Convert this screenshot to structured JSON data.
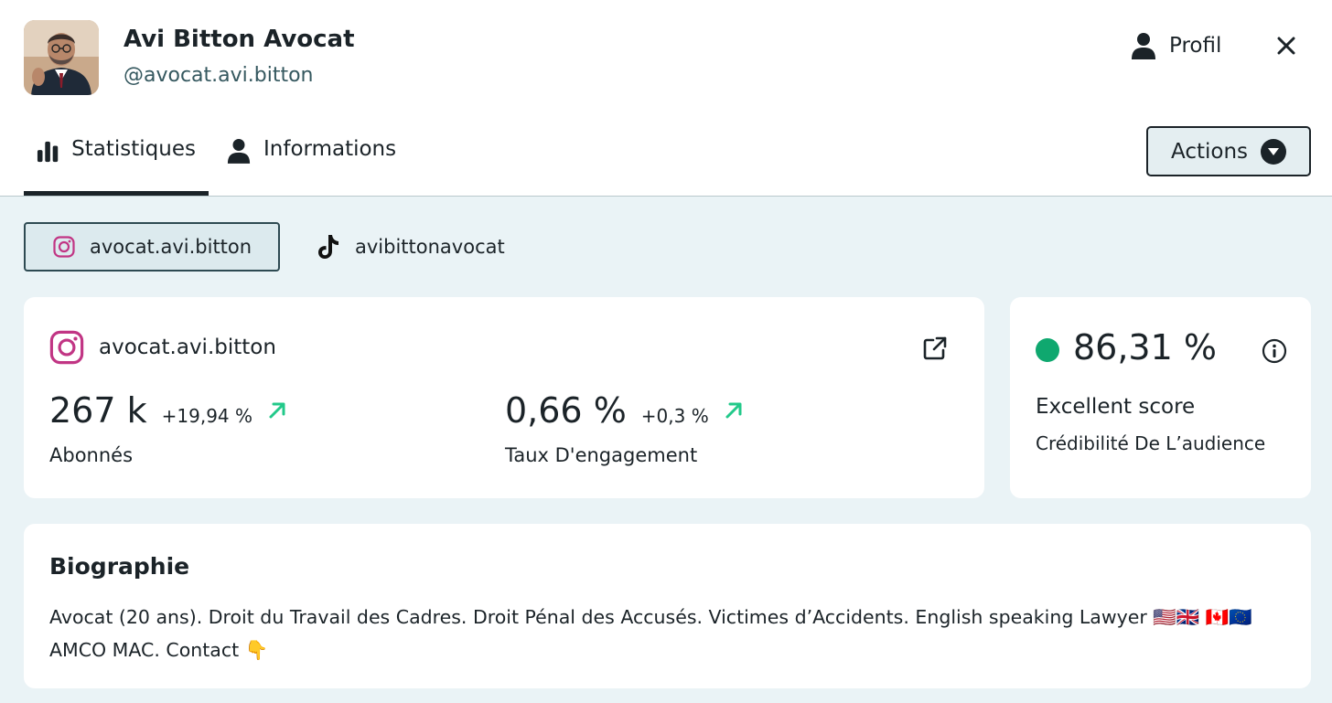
{
  "profile": {
    "name": "Avi Bitton Avocat",
    "handle": "@avocat.avi.bitton",
    "avatar_icon": "avatar-photo"
  },
  "header": {
    "profil_label": "Profil",
    "profil_icon": "user-icon",
    "close_icon": "close-icon"
  },
  "tabs": [
    {
      "label": "Statistiques",
      "icon": "bar-chart-icon",
      "active": true
    },
    {
      "label": "Informations",
      "icon": "user-icon",
      "active": false
    }
  ],
  "actions": {
    "label": "Actions",
    "icon": "caret-down-circle-icon"
  },
  "accounts": [
    {
      "label": "avocat.avi.bitton",
      "icon": "instagram-icon",
      "active": true
    },
    {
      "label": "avibittonavocat",
      "icon": "tiktok-icon",
      "active": false
    }
  ],
  "stats": {
    "account": "avocat.avi.bitton",
    "followers": {
      "value": "267 k",
      "delta": "+19,94 %",
      "label": "Abonnés"
    },
    "engagement": {
      "value": "0,66 %",
      "delta": "+0,3 %",
      "label": "Taux D'engagement"
    }
  },
  "score": {
    "value": "86,31 %",
    "quality": "Excellent score",
    "label": "Crédibilité De L’audience",
    "status_color": "#0fa86f"
  },
  "bio": {
    "title": "Biographie",
    "text": "Avocat (20 ans). Droit du Travail des Cadres. Droit Pénal des Accusés. Victimes d’Accidents. English speaking Lawyer 🇺🇸🇬🇧 🇨🇦🇪🇺 AMCO MAC. Contact 👇"
  },
  "colors": {
    "accent_dark": "#1b2328",
    "background": "#eaf3f6",
    "trend_up": "#22c98a",
    "instagram": "#c13584"
  }
}
